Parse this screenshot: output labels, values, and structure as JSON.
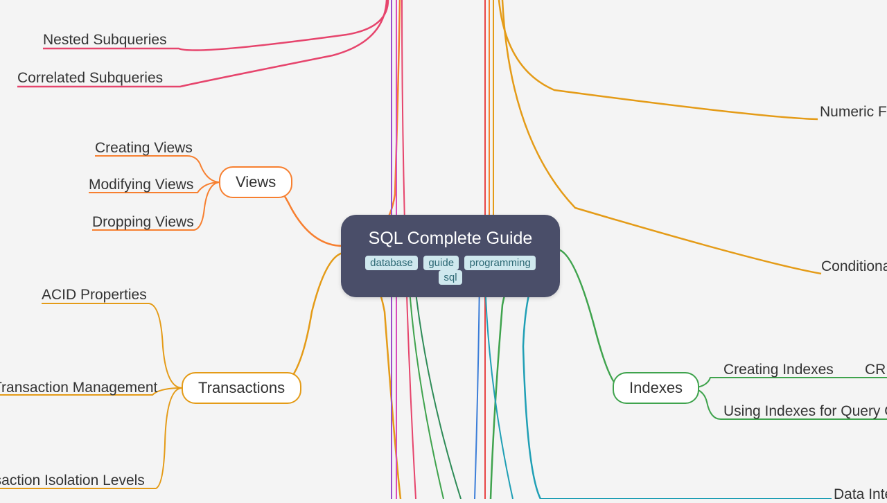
{
  "center": {
    "title": "SQL Complete Guide",
    "tags": [
      "database",
      "guide",
      "programming",
      "sql"
    ]
  },
  "left": {
    "subqueries": {
      "items": [
        "Nested Subqueries",
        "Correlated Subqueries"
      ]
    },
    "views": {
      "label": "Views",
      "items": [
        "Creating Views",
        "Modifying Views",
        "Dropping Views"
      ]
    },
    "transactions": {
      "label": "Transactions",
      "items": [
        "ACID Properties",
        "Transaction Management",
        "nsaction Isolation Levels"
      ]
    }
  },
  "right": {
    "numeric": {
      "label": "Numeric Fu"
    },
    "conditional": {
      "label": "Conditiona"
    },
    "indexes": {
      "label": "Indexes",
      "items": [
        "Creating Indexes",
        "Using Indexes for Query Opt"
      ],
      "extra": "CRE"
    },
    "data_int": {
      "label": "Data Inte"
    }
  },
  "colors": {
    "pink": "#e6446c",
    "orange": "#f77f2f",
    "gold": "#e49b17",
    "green": "#3fa34d",
    "teal": "#1f9fb5",
    "purple": "#9b4dca",
    "magenta": "#d94bbb",
    "red": "#e84545",
    "blue": "#3b7dd8",
    "dgreen": "#2e8b57"
  }
}
